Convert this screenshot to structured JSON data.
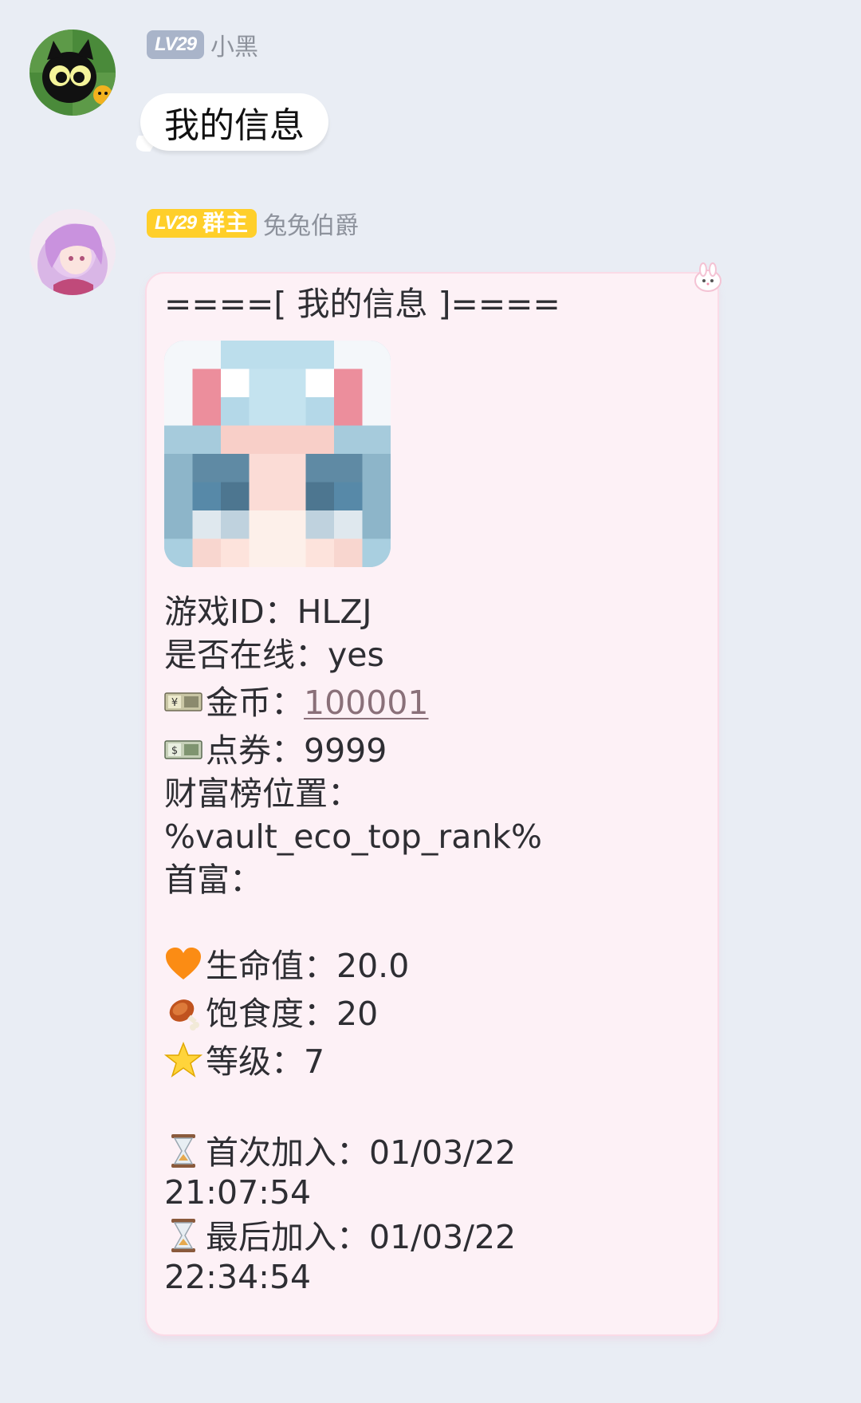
{
  "messages": [
    {
      "level": "LV29",
      "sender": "小黑",
      "text": "我的信息"
    },
    {
      "level": "LV29",
      "role": "群主",
      "sender": "兔兔伯爵",
      "card": {
        "header": "====[ 我的信息 ]====",
        "game_id_label": "游戏ID：",
        "game_id": "HLZJ",
        "online_label": "是否在线：",
        "online": "yes",
        "coins_label": "金币：",
        "coins": "100001",
        "points_label": "点券：",
        "points": "9999",
        "wealth_rank_label": "财富榜位置：",
        "wealth_rank": "%vault_eco_top_rank%",
        "richest_label": "首富：",
        "health_label": "生命值：",
        "health": "20.0",
        "food_label": "饱食度：",
        "food": "20",
        "level_label": "等级：",
        "level_value": "7",
        "first_join_label": "首次加入：",
        "first_join_date": "01/03/22",
        "first_join_time": "21:07:54",
        "last_join_label": "最后加入：",
        "last_join_date": "01/03/22",
        "last_join_time": "22:34:54"
      }
    }
  ],
  "icons": {
    "coin_emoji": "yen-banknote-icon",
    "points_emoji": "dollar-banknote-icon",
    "health_emoji": "orange-heart-icon",
    "food_emoji": "meat-on-bone-icon",
    "level_emoji": "star-icon",
    "time_emoji": "hourglass-icon"
  },
  "colors": {
    "background": "#e9edf4",
    "card_background": "#fdf1f6",
    "owner_badge": "#ffcf2a",
    "level_badge": "#a9b4c9"
  }
}
